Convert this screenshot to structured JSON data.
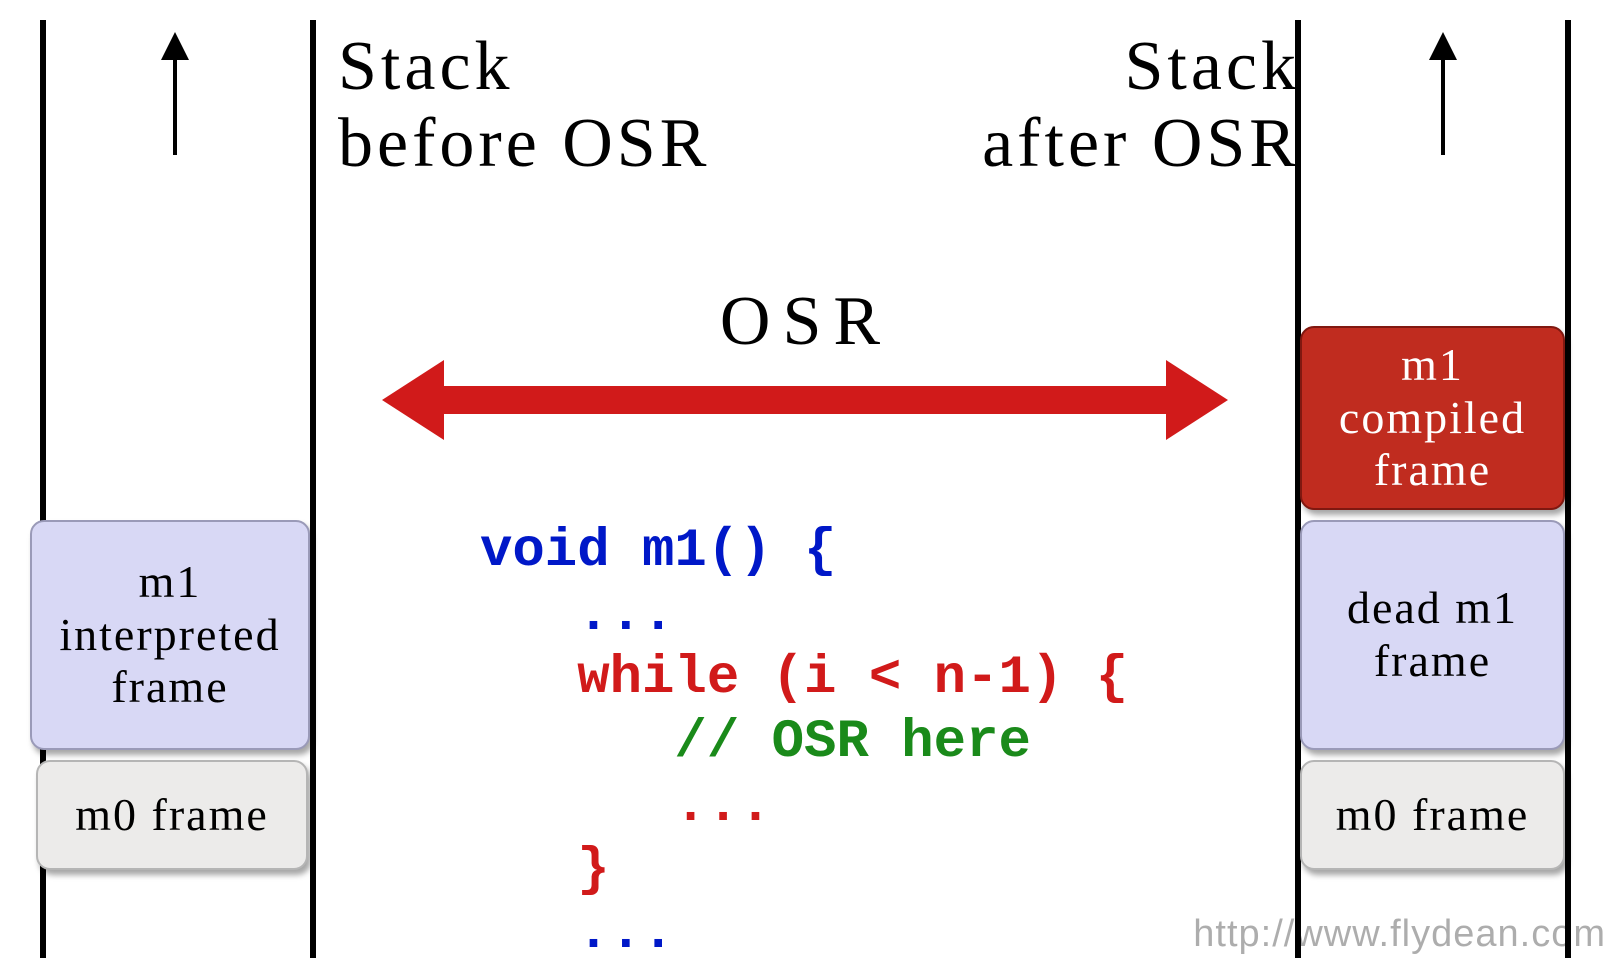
{
  "titles": {
    "left_line1": "Stack",
    "left_line2": "before OSR",
    "right_line1": "Stack",
    "right_line2": "after OSR"
  },
  "osr_label": "OSR",
  "left_stack": {
    "m1": "m1 interpreted frame",
    "m0": "m0 frame"
  },
  "right_stack": {
    "m1c": "m1 compiled frame",
    "m1d": "dead m1 frame",
    "m0": "m0 frame"
  },
  "code": {
    "l1a": "void",
    "l1b": " m1() {",
    "l2": "   ...",
    "l3": "   while (i < n-1) {",
    "l4": "      // OSR here",
    "l5": "      ...",
    "l6": "   }",
    "l7": "   ..."
  },
  "icons": {
    "up_left": "up-arrow",
    "up_right": "up-arrow",
    "double_arrow": "double-arrow"
  },
  "watermark": "http://www.flydean.com",
  "colors": {
    "arrow_red": "#d11a1a",
    "frame_purple": "#d8d8f5",
    "frame_gray": "#ecebea",
    "frame_red": "#c02c1f",
    "code_keyword": "#0018c8",
    "code_comment": "#1a8a1a"
  }
}
